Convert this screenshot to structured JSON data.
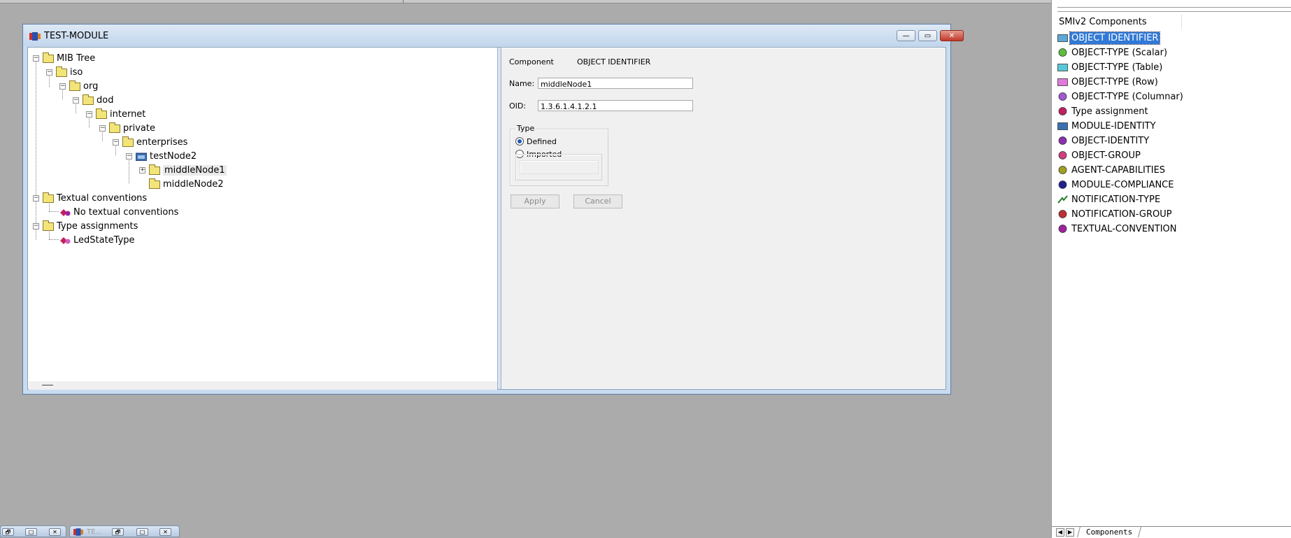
{
  "window": {
    "title": "TEST-MODULE",
    "minimize_glyph": "—",
    "maximize_glyph": "▭",
    "close_glyph": "✕"
  },
  "tree": {
    "root": {
      "label": "MIB Tree",
      "exp": "−"
    },
    "iso": {
      "label": "iso",
      "exp": "−"
    },
    "org": {
      "label": "org",
      "exp": "−"
    },
    "dod": {
      "label": "dod",
      "exp": "−"
    },
    "internet": {
      "label": "internet",
      "exp": "−"
    },
    "private": {
      "label": "private",
      "exp": "−"
    },
    "enterprises": {
      "label": "enterprises",
      "exp": "−"
    },
    "testnode2": {
      "label": "testNode2",
      "exp": "−"
    },
    "middlenode1": {
      "label": "middleNode1",
      "exp": "+"
    },
    "middlenode2": {
      "label": "middleNode2"
    },
    "textual": {
      "label": "Textual conventions",
      "exp": "−"
    },
    "no_textual": {
      "label": "No textual conventions"
    },
    "types": {
      "label": "Type assignments",
      "exp": "−"
    },
    "ledstate": {
      "label": "LedStateType"
    }
  },
  "props": {
    "component_label": "Component",
    "component_value": "OBJECT IDENTIFIER",
    "name_label": "Name:",
    "name_value": "middleNode1",
    "oid_label": "OID:",
    "oid_value": "1.3.6.1.4.1.2.1",
    "type_group": "Type",
    "defined": "Defined",
    "imported": "Imported",
    "apply": "Apply",
    "cancel": "Cancel"
  },
  "components": {
    "title": "SMIv2 Components",
    "items": [
      {
        "label": "OBJECT IDENTIFIER",
        "icon": "folder-blue-icon",
        "color": "#5aa9d6",
        "selected": true
      },
      {
        "label": "OBJECT-TYPE (Scalar)",
        "icon": "scalar-green-icon",
        "color": "#5cbf3a"
      },
      {
        "label": "OBJECT-TYPE (Table)",
        "icon": "table-cyan-icon",
        "color": "#58c8d8"
      },
      {
        "label": "OBJECT-TYPE (Row)",
        "icon": "row-magenta-icon",
        "color": "#e07ad8"
      },
      {
        "label": "OBJECT-TYPE (Columnar)",
        "icon": "columnar-icon",
        "color": "#a05ad0"
      },
      {
        "label": "Type assignment",
        "icon": "type-assignment-icon",
        "color": "#c02060"
      },
      {
        "label": "MODULE-IDENTITY",
        "icon": "module-identity-icon",
        "color": "#3a70b0"
      },
      {
        "label": "OBJECT-IDENTITY",
        "icon": "object-identity-icon",
        "color": "#8a30b0"
      },
      {
        "label": "OBJECT-GROUP",
        "icon": "object-group-icon",
        "color": "#d04080"
      },
      {
        "label": "AGENT-CAPABILITIES",
        "icon": "agent-capabilities-icon",
        "color": "#a0a020"
      },
      {
        "label": "MODULE-COMPLIANCE",
        "icon": "module-compliance-icon",
        "color": "#202090"
      },
      {
        "label": "NOTIFICATION-TYPE",
        "icon": "notification-type-icon",
        "color": "#208020"
      },
      {
        "label": "NOTIFICATION-GROUP",
        "icon": "notification-group-icon",
        "color": "#c03030"
      },
      {
        "label": "TEXTUAL-CONVENTION",
        "icon": "textual-convention-icon",
        "color": "#a020a0"
      }
    ],
    "tab_label": "Components",
    "tab_prev": "◀",
    "tab_next": "▶"
  },
  "minimized": [
    {
      "restore": "🗗",
      "max": "□",
      "close": "✕"
    },
    {
      "title": "TE...",
      "restore": "🗗",
      "max": "□",
      "close": "✕"
    }
  ]
}
